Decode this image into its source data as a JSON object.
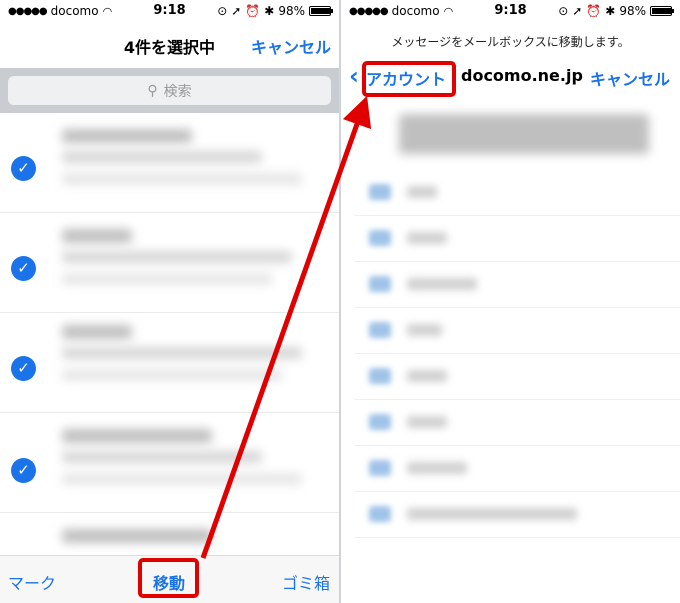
{
  "left": {
    "status": {
      "carrier": "docomo",
      "time": "9:18",
      "battery": "98%",
      "battery_level": 0.98
    },
    "nav": {
      "title": "4件を選択中",
      "cancel": "キャンセル"
    },
    "search": {
      "placeholder": "検索"
    },
    "toolbar": {
      "mark": "マーク",
      "move": "移動",
      "trash": "ゴミ箱"
    },
    "accent": "#1a73e8",
    "highlight": "#e00000"
  },
  "right": {
    "status": {
      "carrier": "docomo",
      "time": "9:18",
      "battery": "98%",
      "battery_level": 0.98
    },
    "message": "メッセージをメールボックスに移動します。",
    "nav": {
      "back": "アカウント",
      "title": "docomo.ne.jp",
      "cancel": "キャンセル"
    }
  },
  "icons": [
    "wifi-icon",
    "search-icon",
    "checkmark-icon",
    "chevron-left-icon",
    "battery-icon",
    "alarm-icon",
    "bluetooth-icon",
    "location-icon"
  ]
}
